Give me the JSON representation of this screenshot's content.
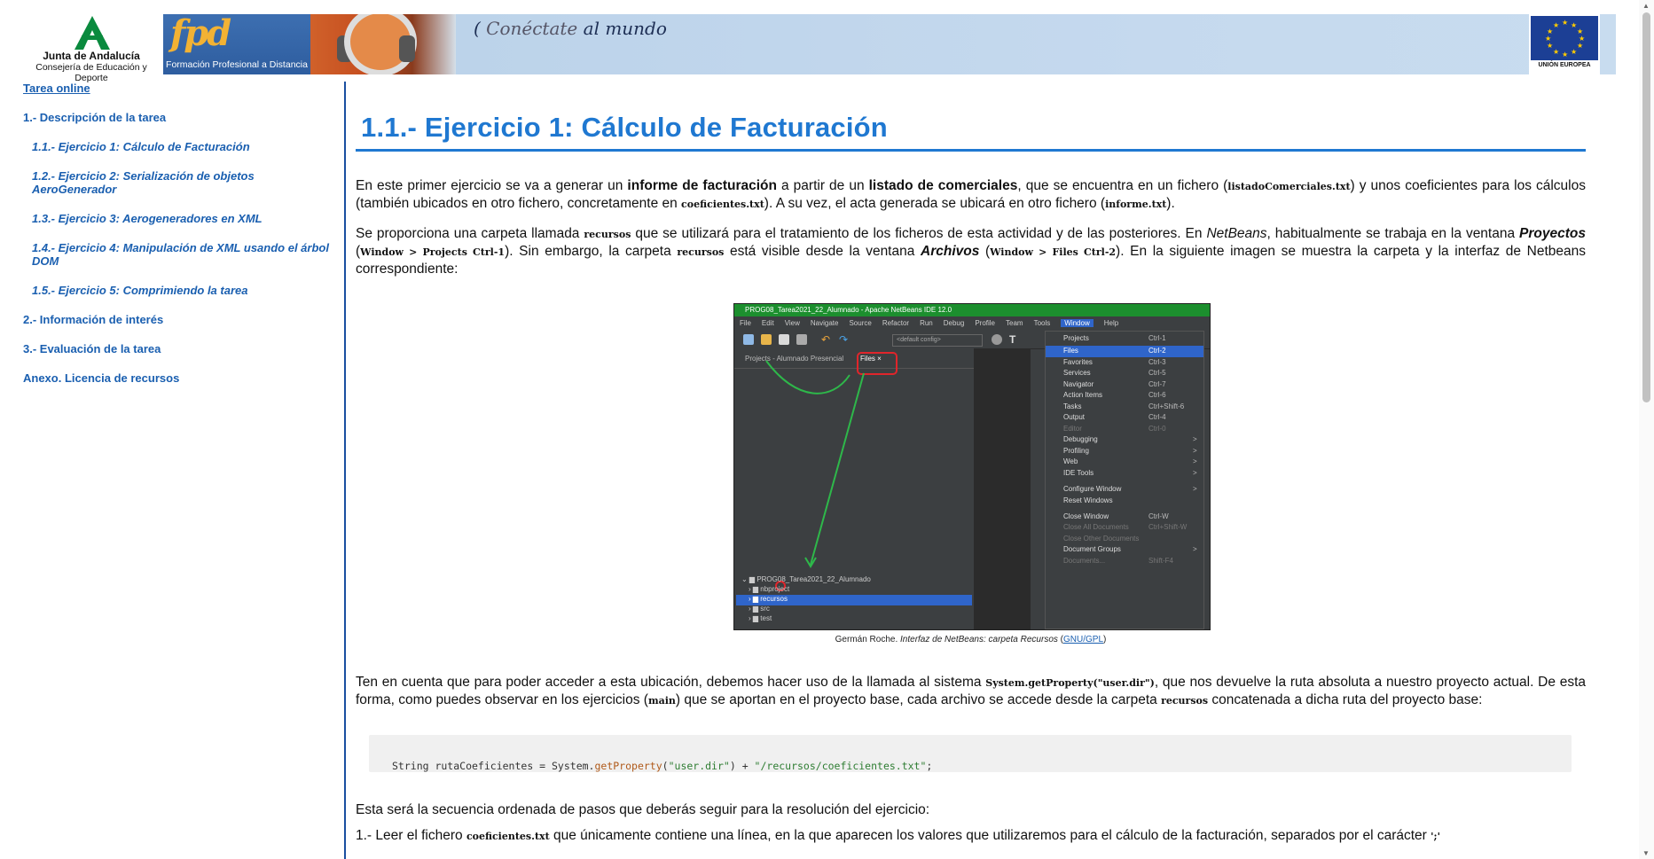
{
  "header": {
    "junta_name": "Junta de Andalucía",
    "junta_sub": "Consejería de Educación y Deporte",
    "fpd_logo": "fpd",
    "fpd_text": "Formación Profesional a Distancia",
    "slogan_a": "Conéctate",
    "slogan_b": "al mundo",
    "eu_label": "UNIÓN EUROPEA"
  },
  "sidebar": {
    "top_link": "Tarea online",
    "items": [
      {
        "label": "1.- Descripción de la tarea",
        "type": "section"
      },
      {
        "label": "1.1.- Ejercicio 1: Cálculo de Facturación",
        "type": "sub"
      },
      {
        "label": "1.2.- Ejercicio 2: Serialización de objetos AeroGenerador",
        "type": "sub"
      },
      {
        "label": "1.3.- Ejercicio 3: Aerogeneradores en XML",
        "type": "sub"
      },
      {
        "label": "1.4.- Ejercicio 4: Manipulación de XML usando el árbol DOM",
        "type": "sub"
      },
      {
        "label": "1.5.- Ejercicio 5: Comprimiendo la tarea",
        "type": "sub"
      },
      {
        "label": "2.- Información de interés",
        "type": "section"
      },
      {
        "label": "3.- Evaluación de la tarea",
        "type": "section"
      },
      {
        "label": "Anexo. Licencia de recursos",
        "type": "section"
      }
    ]
  },
  "main": {
    "title": "1.1.- Ejercicio 1: Cálculo de Facturación",
    "p1": {
      "a": "En este primer ejercicio se va a generar un ",
      "b": "informe de facturación",
      "c": " a partir de un ",
      "d": "listado de comerciales",
      "e": ", que se encuentra en un fichero (",
      "f": "listadoComerciales.txt",
      "g": ") y unos coeficientes para los cálculos (también ubicados en otro fichero, concretamente en ",
      "h": "coeficientes.txt",
      "i": "). A su vez, el acta generada se ubicará en otro fichero (",
      "j": "informe.txt",
      "k": ")."
    },
    "p2": {
      "a": "Se proporciona una carpeta llamada ",
      "b": "recursos",
      "c": " que se utilizará para el tratamiento de los ficheros de esta actividad y de las posteriores. En ",
      "d": "NetBeans",
      "e": ", habitualmente se trabaja en la ventana ",
      "f": "Proyectos",
      "g": " (",
      "h": "Window > Projects  Ctrl-1",
      "i": "). Sin embargo, la carpeta ",
      "j": "recursos",
      "k": " está visible desde la ventana ",
      "l": "Archivos",
      "m": " (",
      "n": "Window > Files  Ctrl-2",
      "o": "). En la siguiente imagen se muestra la carpeta y la interfaz de Netbeans correspondiente:"
    },
    "caption": {
      "author": "Germán Roche. ",
      "title": "Interfaz de NetBeans: carpeta Recursos",
      "open": " (",
      "license": "GNU/GPL",
      "close": ")"
    },
    "p3": {
      "a": "Ten en cuenta que para poder acceder a esta ubicación, debemos hacer uso de la llamada al sistema ",
      "b": "System.getProperty(\"user.dir\")",
      "c": ", que nos devuelve la ruta absoluta a nuestro proyecto actual. De esta forma, como puedes observar en los ejercicios (",
      "d": "main",
      "e": ") que se aportan en el proyecto base, cada archivo se accede desde la carpeta ",
      "f": "recursos",
      "g": " concatenada a dicha ruta del proyecto base:"
    },
    "code": {
      "a": "String rutaCoeficientes = System.",
      "fn": "getProperty",
      "b": "(",
      "s1": "\"user.dir\"",
      "c": ") + ",
      "s2": "\"/recursos/coeficientes.txt\"",
      "d": ";"
    },
    "p4": "Esta será la secuencia ordenada de pasos que deberás seguir para la resolución del ejercicio:",
    "p5": {
      "a": "1.- Leer el fichero ",
      "b": "coeficientes.txt",
      "c": " que únicamente contiene una línea, en la que aparecen los valores que utilizaremos para el cálculo de la facturación, separados por el carácter ",
      "d": "';'"
    }
  },
  "figure": {
    "window_title": "PROG08_Tarea2021_22_Alumnado - Apache NetBeans IDE 12.0",
    "menu": [
      "File",
      "Edit",
      "View",
      "Navigate",
      "Source",
      "Refactor",
      "Run",
      "Debug",
      "Profile",
      "Team",
      "Tools",
      "Window",
      "Help"
    ],
    "config": "<default config>",
    "tab_projects": "Projects - Alumnado Presencial",
    "tab_files": "Files ×",
    "window_menu": [
      {
        "label": "Projects",
        "key": "Ctrl-1"
      },
      {
        "label": "Files",
        "key": "Ctrl-2"
      },
      {
        "label": "Favorites",
        "key": "Ctrl-3"
      },
      {
        "label": "Services",
        "key": "Ctrl-5"
      },
      {
        "label": "Navigator",
        "key": "Ctrl-7"
      },
      {
        "label": "Action Items",
        "key": "Ctrl-6"
      },
      {
        "label": "Tasks",
        "key": "Ctrl+Shift-6"
      },
      {
        "label": "Output",
        "key": "Ctrl-4"
      },
      {
        "label": "Editor",
        "key": "Ctrl-0"
      },
      {
        "label": "Debugging",
        "key": ">"
      },
      {
        "label": "Profiling",
        "key": ">"
      },
      {
        "label": "Web",
        "key": ">"
      },
      {
        "label": "IDE Tools",
        "key": ">"
      },
      {
        "label": "Configure Window",
        "key": ">"
      },
      {
        "label": "Reset Windows",
        "key": ""
      },
      {
        "label": "Close Window",
        "key": "Ctrl-W"
      },
      {
        "label": "Close All Documents",
        "key": "Ctrl+Shift-W"
      },
      {
        "label": "Close Other Documents",
        "key": ""
      },
      {
        "label": "Document Groups",
        "key": ">"
      },
      {
        "label": "Documents...",
        "key": "Shift-F4"
      }
    ],
    "tree": [
      "PROG08_Tarea2021_22_Alumnado",
      "nbproject",
      "recursos",
      "src",
      "test"
    ]
  }
}
